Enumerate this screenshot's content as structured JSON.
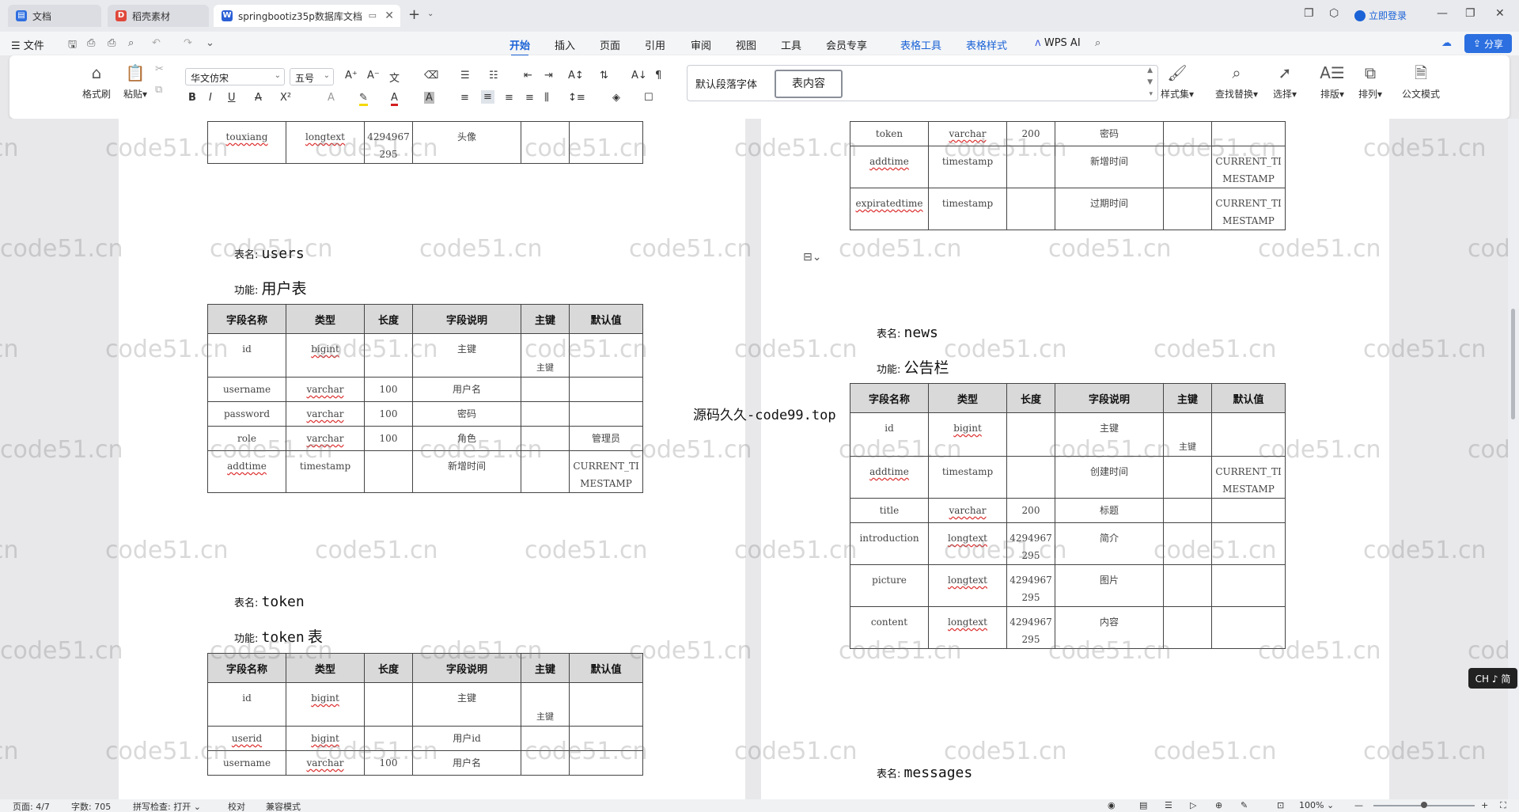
{
  "tabs": [
    {
      "label": "文档",
      "icon": "doc-icon",
      "color": "#2f6fe0"
    },
    {
      "label": "稻壳素材",
      "icon": "docer-icon",
      "color": "#e0483a"
    },
    {
      "label": "springbootiz35p数据库文档",
      "icon": "wps-writer-icon",
      "color": "#2a5fd6"
    }
  ],
  "titlebar": {
    "login_label": "立即登录"
  },
  "menu": {
    "file": "文件",
    "items": [
      "开始",
      "插入",
      "页面",
      "引用",
      "审阅",
      "视图",
      "工具",
      "会员专享"
    ],
    "context_items": [
      "表格工具",
      "表格样式"
    ],
    "wps_ai": "WPS AI",
    "share": "分享"
  },
  "ribbon": {
    "format_painter": "格式刷",
    "paste": "粘贴",
    "font_name": "华文仿宋",
    "font_size": "五号",
    "style_default": "默认段落字体",
    "style_table": "表内容",
    "style_set": "样式集",
    "find_replace": "查找替换",
    "select": "选择",
    "layout": "排版",
    "arrange": "排列",
    "official_mode": "公文模式"
  },
  "doc": {
    "headers": [
      "字段名称",
      "类型",
      "长度",
      "字段说明",
      "主键",
      "默认值"
    ],
    "table_label": "表名:",
    "func_label": "功能:",
    "left_top_rows": [
      [
        "touxiang",
        "longtext",
        "4294967295",
        "头像",
        "",
        ""
      ]
    ],
    "users": {
      "name": "users",
      "func": "用户表",
      "rows": [
        [
          "id",
          "bigint",
          "",
          "主键",
          "主键",
          ""
        ],
        [
          "username",
          "varchar",
          "100",
          "用户名",
          "",
          ""
        ],
        [
          "password",
          "varchar",
          "100",
          "密码",
          "",
          ""
        ],
        [
          "role",
          "varchar",
          "100",
          "角色",
          "",
          "管理员"
        ],
        [
          "addtime",
          "timestamp",
          "",
          "新增时间",
          "",
          "CURRENT_TIMESTAMP"
        ]
      ]
    },
    "token": {
      "name": "token",
      "func_en": "token",
      "func_zh": "表",
      "rows": [
        [
          "id",
          "bigint",
          "",
          "主键",
          "主键",
          ""
        ],
        [
          "userid",
          "bigint",
          "",
          "用户id",
          "",
          ""
        ],
        [
          "username",
          "varchar",
          "100",
          "用户名",
          "",
          ""
        ]
      ]
    },
    "right_top_rows": [
      [
        "token",
        "varchar",
        "200",
        "密码",
        "",
        ""
      ],
      [
        "addtime",
        "timestamp",
        "",
        "新增时间",
        "",
        "CURRENT_TIMESTAMP"
      ],
      [
        "expiratedtime",
        "timestamp",
        "",
        "过期时间",
        "",
        "CURRENT_TIMESTAMP"
      ]
    ],
    "news": {
      "name": "news",
      "func": "公告栏",
      "rows": [
        [
          "id",
          "bigint",
          "",
          "主键",
          "主键",
          ""
        ],
        [
          "addtime",
          "timestamp",
          "",
          "创建时间",
          "",
          "CURRENT_TIMESTAMP"
        ],
        [
          "title",
          "varchar",
          "200",
          "标题",
          "",
          ""
        ],
        [
          "introduction",
          "longtext",
          "4294967295",
          "简介",
          "",
          ""
        ],
        [
          "picture",
          "longtext",
          "4294967295",
          "图片",
          "",
          ""
        ],
        [
          "content",
          "longtext",
          "4294967295",
          "内容",
          "",
          ""
        ]
      ]
    },
    "messages": {
      "name": "messages"
    },
    "source_label": "源码久久-code99.top",
    "watermark": "code51.cn"
  },
  "status": {
    "page": "页面: 4/7",
    "words": "字数: 705",
    "spell": "拼写检查: 打开",
    "proof": "校对",
    "compat": "兼容模式",
    "zoom": "100%"
  },
  "ime": "CH ♪ 简"
}
